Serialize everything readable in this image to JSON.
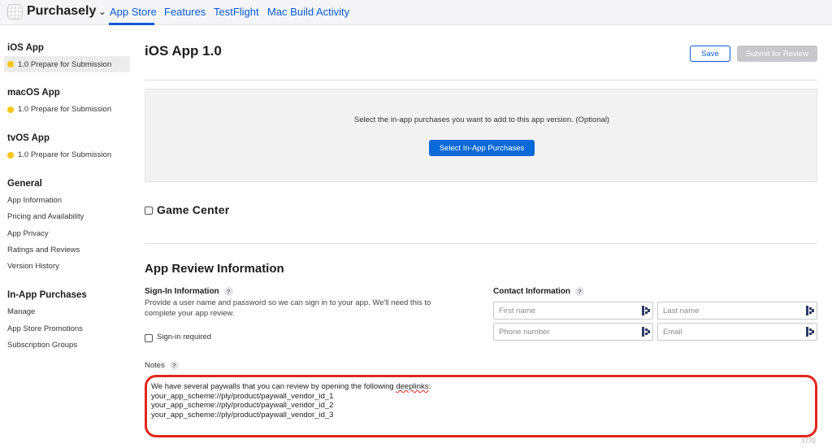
{
  "topbar": {
    "app_name": "Purchasely",
    "tabs": [
      "App Store",
      "Features",
      "TestFlight",
      "Mac Build Activity"
    ],
    "active_tab": "App Store",
    "accent": "#0a5bd8"
  },
  "sidebar": {
    "platforms": [
      {
        "heading": "iOS App",
        "status": "1.0 Prepare for Submission",
        "selected": true
      },
      {
        "heading": "macOS App",
        "status": "1.0 Prepare for Submission",
        "selected": false
      },
      {
        "heading": "tvOS App",
        "status": "1.0 Prepare for Submission",
        "selected": false
      }
    ],
    "general": {
      "heading": "General",
      "items": [
        "App Information",
        "Pricing and Availability",
        "App Privacy",
        "Ratings and Reviews",
        "Version History"
      ]
    },
    "iap": {
      "heading": "In-App Purchases",
      "items": [
        "Manage",
        "App Store Promotions",
        "Subscription Groups"
      ]
    },
    "status_dot_color": "#f5c518"
  },
  "main": {
    "title": "iOS App 1.0",
    "save_label": "Save",
    "submit_label": "Submit for Review",
    "iap_prompt": "Select the in-app purchases you want to add to this app version. (Optional)",
    "iap_button": "Select In-App Purchases",
    "game_center": "Game Center",
    "review_title": "App Review Information",
    "signin_label": "Sign-In Information",
    "signin_desc": "Provide a user name and password so we can sign in to your app. We'll need this to complete your app review.",
    "signin_required": "Sign-in required",
    "contact_label": "Contact Information",
    "fields": {
      "first_name": "First name",
      "last_name": "Last name",
      "phone": "Phone number",
      "email": "Email"
    },
    "notes_label": "Notes",
    "notes_lines": {
      "line1_pre": "We have several paywalls that you can review by opening the following ",
      "line1_word": "deeplinks",
      "line1_post": ":",
      "line2": "your_app_scheme://ply/product/paywall_vendor_id_1",
      "line3": "your_app_scheme://ply/product/paywall_vendor_id_2",
      "line4": "your_app_scheme://ply/product/paywall_vendor_id_3"
    },
    "counter": "3770",
    "highlight_color": "#e0271c"
  }
}
